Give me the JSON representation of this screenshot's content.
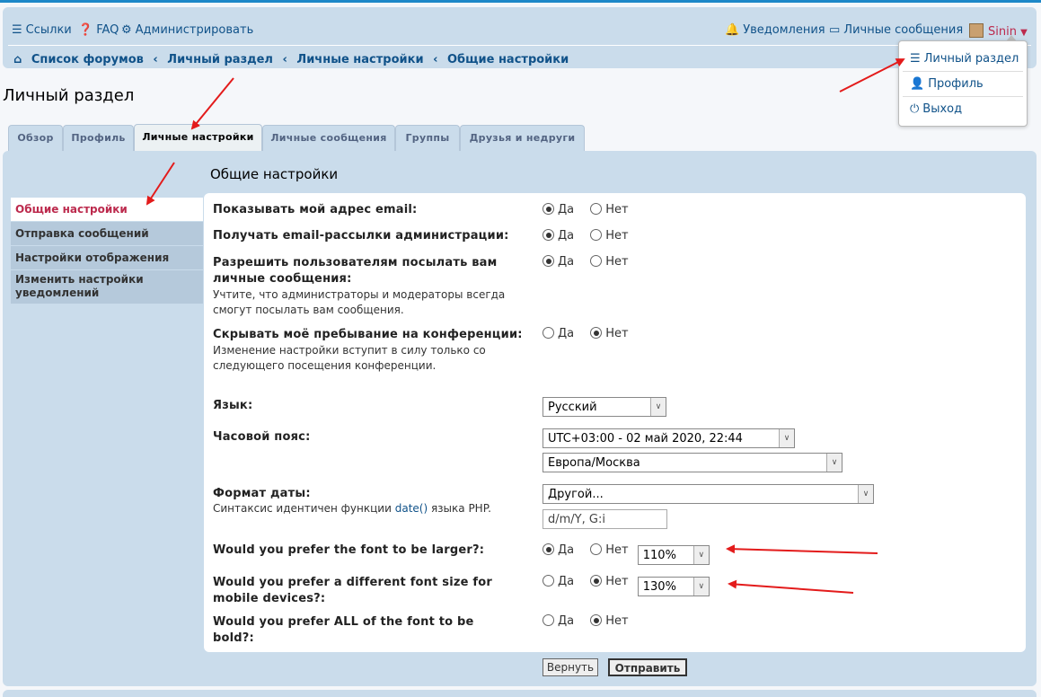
{
  "colors": {
    "accent": "#105289",
    "active": "#bc2a4d",
    "panel": "#cadceb",
    "annotation": "#e31b1b"
  },
  "nav": {
    "links": {
      "icon": "bars-icon",
      "label": "Ссылки"
    },
    "faq": {
      "icon": "question-circle-icon",
      "label": "FAQ"
    },
    "admin": {
      "icon": "cogs-icon",
      "label": "Администрировать"
    },
    "notifications": {
      "icon": "bell-icon",
      "label": "Уведомления"
    },
    "messages": {
      "icon": "inbox-icon",
      "label": "Личные сообщения"
    },
    "user": {
      "name": "Sinin"
    }
  },
  "breadcrumb": {
    "home_icon": "home-icon",
    "items": [
      "Список форумов",
      "Личный раздел",
      "Личные настройки",
      "Общие настройки"
    ],
    "separator": "‹"
  },
  "user_menu": {
    "items": [
      {
        "icon": "sliders-icon",
        "label": "Личный раздел"
      },
      {
        "icon": "user-icon",
        "label": "Профиль"
      },
      {
        "icon": "power-icon",
        "label": "Выход"
      }
    ]
  },
  "page": {
    "title": "Личный раздел",
    "section_title": "Общие настройки"
  },
  "tabs": [
    "Обзор",
    "Профиль",
    "Личные настройки",
    "Личные сообщения",
    "Группы",
    "Друзья и недруги"
  ],
  "active_tab": "Личные настройки",
  "side_menu": [
    "Общие настройки",
    "Отправка сообщений",
    "Настройки отображения",
    "Изменить настройки уведомлений"
  ],
  "form": {
    "yes": "Да",
    "no": "Нет",
    "show_email": {
      "label": "Показывать мой адрес email:",
      "value": "Да"
    },
    "admin_email": {
      "label": "Получать email-рассылки администрации:",
      "value": "Да"
    },
    "allow_pm": {
      "label": "Разрешить пользователям посылать вам личные сообщения:",
      "explain": "Учтите, что администраторы и модераторы всегда смогут посылать вам сообщения.",
      "value": "Да"
    },
    "hide_online": {
      "label": "Скрывать моё пребывание на конференции:",
      "explain": "Изменение настройки вступит в силу только со следующего посещения конференции.",
      "value": "Нет"
    },
    "language": {
      "label": "Язык:",
      "value": "Русский"
    },
    "timezone": {
      "label": "Часовой пояс:",
      "offset": "UTC+03:00 - 02 май 2020, 22:44",
      "zone": "Европа/Москва"
    },
    "dateformat": {
      "label": "Формат даты:",
      "explain_prefix": "Синтаксис идентичен функции ",
      "explain_link": "date()",
      "explain_suffix": " языка PHP.",
      "select": "Другой...",
      "custom": "d/m/Y, G:i"
    },
    "font_larger": {
      "label": "Would you prefer the font to be larger?:",
      "value": "Да",
      "size": "110%"
    },
    "font_mobile": {
      "label": "Would you prefer a different font size for mobile devices?:",
      "value": "Нет",
      "size": "130%"
    },
    "font_bold": {
      "label": "Would you prefer ALL of the font to be bold?:",
      "value": "Нет"
    }
  },
  "buttons": {
    "reset": "Вернуть",
    "submit": "Отправить"
  }
}
